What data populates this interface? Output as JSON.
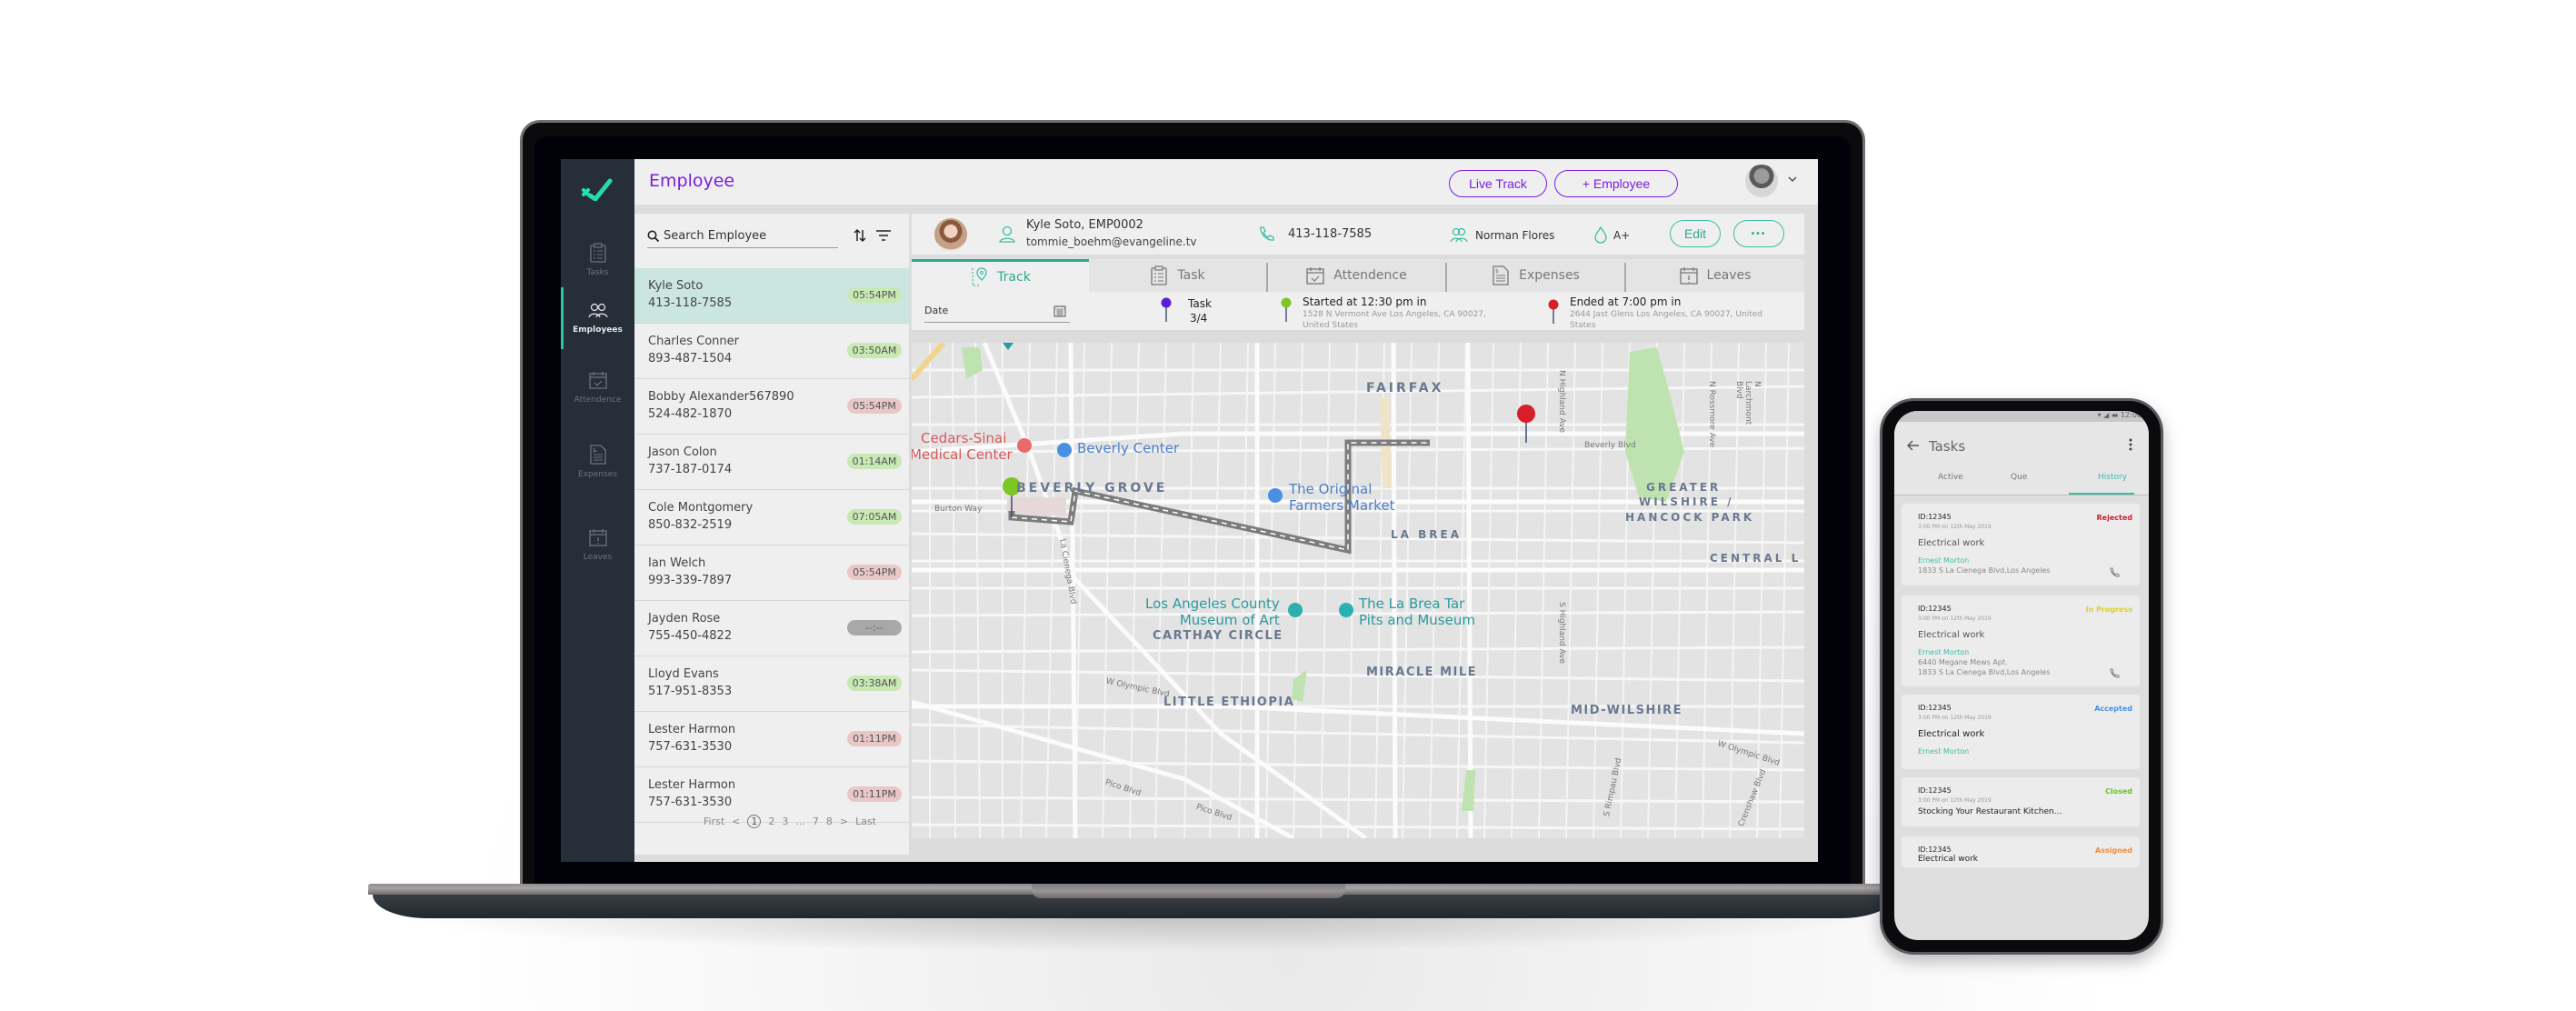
{
  "app": {
    "page_title": "Employee",
    "live_track_label": "Live Track",
    "add_employee_label": "+ Employee",
    "brand_color": "#7a1ee0",
    "accent_color": "#2aa98f"
  },
  "sidebar": {
    "items": [
      {
        "label": "Tasks",
        "icon": "clipboard-icon",
        "active": false
      },
      {
        "label": "Employees",
        "icon": "users-icon",
        "active": true
      },
      {
        "label": "Attendence",
        "icon": "calendar-check-icon",
        "active": false
      },
      {
        "label": "Expenses",
        "icon": "invoice-icon",
        "active": false
      },
      {
        "label": "Leaves",
        "icon": "calendar-alert-icon",
        "active": false
      }
    ]
  },
  "employee_list": {
    "search_placeholder": "Search Employee",
    "rows": [
      {
        "name": "Kyle Soto",
        "phone": "413-118-7585",
        "time": "05:54PM",
        "status": "green",
        "selected": true
      },
      {
        "name": "Charles Conner",
        "phone": "893-487-1504",
        "time": "03:50AM",
        "status": "green"
      },
      {
        "name": "Bobby Alexander567890",
        "phone": "524-482-1870",
        "time": "05:54PM",
        "status": "red"
      },
      {
        "name": "Jason Colon",
        "phone": "737-187-0174",
        "time": "01:14AM",
        "status": "green"
      },
      {
        "name": "Cole Montgomery",
        "phone": "850-832-2519",
        "time": "07:05AM",
        "status": "green"
      },
      {
        "name": "Ian Welch",
        "phone": "993-339-7897",
        "time": "05:54PM",
        "status": "red"
      },
      {
        "name": "Jayden Rose",
        "phone": "755-450-4822",
        "time": "--:--",
        "status": "grey"
      },
      {
        "name": "Lloyd Evans",
        "phone": "517-951-8353",
        "time": "03:38AM",
        "status": "green"
      },
      {
        "name": "Lester Harmon",
        "phone": "757-631-3530",
        "time": "01:11PM",
        "status": "red"
      },
      {
        "name": "Lester Harmon",
        "phone": "757-631-3530",
        "time": "01:11PM",
        "status": "red"
      }
    ],
    "pagination": {
      "first": "First",
      "prev": "<",
      "pages": [
        "1",
        "2",
        "3",
        "...",
        "7",
        "8"
      ],
      "current": "1",
      "next": ">",
      "last": "Last"
    }
  },
  "employee_header": {
    "name_id": "Kyle Soto, EMP0002",
    "email": "tommie_boehm@evangeline.tv",
    "phone": "413-118-7585",
    "manager": "Norman Flores",
    "blood_group": "A+",
    "edit_label": "Edit",
    "more_label": "•••"
  },
  "tabs": [
    {
      "label": "Track",
      "icon": "route-pin-icon",
      "active": true
    },
    {
      "label": "Task",
      "icon": "clipboard-icon",
      "active": false
    },
    {
      "label": "Attendence",
      "icon": "calendar-check-icon",
      "active": false
    },
    {
      "label": "Expenses",
      "icon": "invoice-icon",
      "active": false
    },
    {
      "label": "Leaves",
      "icon": "calendar-alert-icon",
      "active": false
    }
  ],
  "track_info": {
    "date_label": "Date",
    "task_label": "Task",
    "task_progress": "3/4",
    "started_title": "Started at 12:30 pm in",
    "started_address": "1528 N Vermont Ave Los Angeles, CA  90027, United States",
    "ended_title": "Ended at 7:00 pm in",
    "ended_address": "2644 Jast Glens Los Angeles, CA  90027, United States",
    "task_pin_color": "#5b1fd1",
    "start_pin_color": "#7cc625",
    "end_pin_color": "#d61f2b"
  },
  "map": {
    "neighborhoods": [
      "FAIRFAX",
      "BEVERLY GROVE",
      "LA BREA",
      "GREATER",
      "WILSHIRE /",
      "HANCOCK PARK",
      "CENTRAL L",
      "CARTHAY CIRCLE",
      "MIRACLE MILE",
      "LITTLE ETHIOPIA",
      "MID-WILSHIRE"
    ],
    "pois": {
      "cedars_1": "Cedars-Sinai",
      "cedars_2": "Medical Center",
      "beverly_center": "Beverly Center",
      "farmers_1": "The Original",
      "farmers_2": "Farmers Market",
      "lacma_1": "Los Angeles County",
      "lacma_2": "Museum of Art",
      "tarpits_1": "The La Brea Tar",
      "tarpits_2": "Pits and Museum"
    },
    "streets": {
      "burton": "Burton Way",
      "la_cienega": "La Cienega Blvd",
      "beverly_blvd": "Beverly Blvd",
      "n_highland": "N Highland Ave",
      "s_highland": "S Highland Ave",
      "n_rossmore": "N Rossmore Ave",
      "n_larchmont": "N Larchmont Blvd",
      "w_olympic_1": "W Olympic Blvd",
      "w_olympic_2": "W Olympic Blvd",
      "pico_1": "Pico Blvd",
      "pico_2": "Pico Blvd",
      "s_rimpau": "S Rimpau Blvd",
      "crenshaw": "Crenshaw Blvd"
    }
  },
  "phone": {
    "status_time": "12:00",
    "title": "Tasks",
    "tabs": [
      {
        "label": "Active",
        "active": false
      },
      {
        "label": "Que",
        "active": false
      },
      {
        "label": "History",
        "active": true
      }
    ],
    "cards": [
      {
        "id": "ID:12345",
        "datetime": "3:00 PM on 12th May 2019",
        "status": "Rejected",
        "status_color": "#d11a2a",
        "title": "Electrical work",
        "name": "Ernest Morton",
        "address_1": "1833 S La Cienega Blvd,Los Angeles",
        "address_2": ""
      },
      {
        "id": "ID:12345",
        "datetime": "3:00 PM on 12th May 2019",
        "status": "In Progress",
        "status_color": "#e0cf2a",
        "title": "Electrical work",
        "name": "Ernest Morton",
        "address_1": "6440 Megane Mews Apt.",
        "address_2": "1833 S La Cienega Blvd,Los Angeles"
      },
      {
        "id": "ID:12345",
        "datetime": "3:00 PM on 12th May 2019",
        "status": "Accepted",
        "status_color": "#4a90e2",
        "title": "Electrical work",
        "name": "Ernest Morton"
      },
      {
        "id": "ID:12345",
        "datetime": "3:00 PM on 12th May 2019",
        "status": "Closed",
        "status_color": "#6cc329",
        "title": "Stocking Your Restaurant Kitchen..."
      },
      {
        "id": "ID:12345",
        "status": "Assigned",
        "status_color": "#f08a3c",
        "title": "Electrical work"
      }
    ]
  }
}
